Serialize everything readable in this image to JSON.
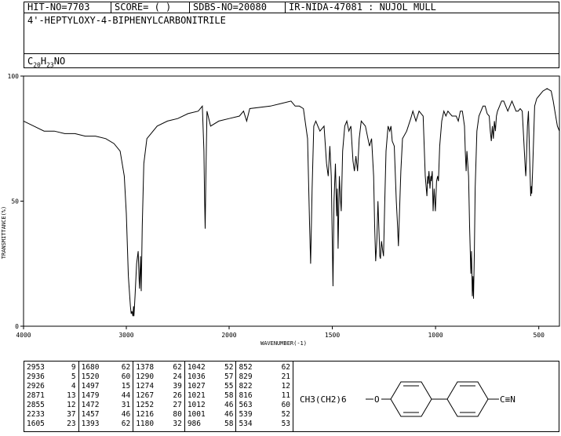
{
  "header": {
    "hit": "HIT-NO=7703",
    "score": "SCORE=  (   )",
    "sdbs": "SDBS-NO=20080",
    "ir": "IR-NIDA-47081 : NUJOL MULL"
  },
  "compound_name": "4'-HEPTYLOXY-4-BIPHENYLCARBONITRILE",
  "formula": {
    "c": "C",
    "c_n": "20",
    "h": "H",
    "h_n": "23",
    "rest": "NO"
  },
  "structure": {
    "left_group": "CH3(CH2)6",
    "o": "O",
    "cn": "C≡N"
  },
  "peaks": [
    [
      [
        2953,
        9
      ],
      [
        2936,
        5
      ],
      [
        2926,
        4
      ],
      [
        2871,
        13
      ],
      [
        2855,
        12
      ],
      [
        2233,
        37
      ],
      [
        1605,
        23
      ]
    ],
    [
      [
        1680,
        62
      ],
      [
        1520,
        60
      ],
      [
        1497,
        15
      ],
      [
        1479,
        44
      ],
      [
        1472,
        31
      ],
      [
        1457,
        46
      ],
      [
        1393,
        62
      ]
    ],
    [
      [
        1378,
        62
      ],
      [
        1290,
        24
      ],
      [
        1274,
        39
      ],
      [
        1267,
        26
      ],
      [
        1252,
        27
      ],
      [
        1216,
        80
      ],
      [
        1180,
        32
      ]
    ],
    [
      [
        1042,
        52
      ],
      [
        1036,
        57
      ],
      [
        1027,
        55
      ],
      [
        1021,
        58
      ],
      [
        1012,
        46
      ],
      [
        1001,
        46
      ],
      [
        986,
        58
      ]
    ],
    [
      [
        852,
        62
      ],
      [
        829,
        21
      ],
      [
        822,
        12
      ],
      [
        816,
        11
      ],
      [
        563,
        60
      ],
      [
        539,
        52
      ],
      [
        534,
        53
      ]
    ]
  ],
  "chart_data": {
    "type": "line",
    "xlabel": "WAVENUMBER(-1)",
    "ylabel": "TRANSMITTANCE(%)",
    "xlim": [
      4000,
      400
    ],
    "ylim": [
      0,
      100
    ],
    "x_ticks": [
      "4000",
      "3000",
      "2000",
      "1500",
      "1000",
      "500"
    ],
    "y_ticks": [
      "100",
      "50",
      "0"
    ],
    "points": [
      [
        4000,
        82
      ],
      [
        3900,
        80
      ],
      [
        3800,
        78
      ],
      [
        3700,
        78
      ],
      [
        3600,
        77
      ],
      [
        3500,
        77
      ],
      [
        3400,
        76
      ],
      [
        3300,
        76
      ],
      [
        3200,
        75
      ],
      [
        3120,
        73
      ],
      [
        3060,
        70
      ],
      [
        3020,
        60
      ],
      [
        3000,
        45
      ],
      [
        2980,
        20
      ],
      [
        2960,
        8
      ],
      [
        2953,
        5
      ],
      [
        2945,
        6
      ],
      [
        2936,
        4
      ],
      [
        2930,
        8
      ],
      [
        2926,
        4
      ],
      [
        2915,
        12
      ],
      [
        2900,
        25
      ],
      [
        2885,
        30
      ],
      [
        2875,
        18
      ],
      [
        2871,
        15
      ],
      [
        2862,
        28
      ],
      [
        2855,
        14
      ],
      [
        2845,
        40
      ],
      [
        2830,
        65
      ],
      [
        2800,
        75
      ],
      [
        2700,
        80
      ],
      [
        2600,
        82
      ],
      [
        2500,
        83
      ],
      [
        2400,
        85
      ],
      [
        2300,
        86
      ],
      [
        2260,
        88
      ],
      [
        2245,
        70
      ],
      [
        2238,
        50
      ],
      [
        2233,
        39
      ],
      [
        2226,
        60
      ],
      [
        2215,
        86
      ],
      [
        2180,
        80
      ],
      [
        2100,
        82
      ],
      [
        2000,
        83
      ],
      [
        1950,
        84
      ],
      [
        1930,
        86
      ],
      [
        1915,
        82
      ],
      [
        1900,
        87
      ],
      [
        1800,
        88
      ],
      [
        1750,
        89
      ],
      [
        1700,
        90
      ],
      [
        1680,
        88
      ],
      [
        1660,
        88
      ],
      [
        1640,
        87
      ],
      [
        1620,
        75
      ],
      [
        1610,
        40
      ],
      [
        1605,
        25
      ],
      [
        1598,
        55
      ],
      [
        1590,
        80
      ],
      [
        1580,
        82
      ],
      [
        1570,
        80
      ],
      [
        1560,
        78
      ],
      [
        1540,
        80
      ],
      [
        1528,
        65
      ],
      [
        1520,
        60
      ],
      [
        1512,
        72
      ],
      [
        1505,
        60
      ],
      [
        1497,
        16
      ],
      [
        1492,
        50
      ],
      [
        1485,
        65
      ],
      [
        1479,
        44
      ],
      [
        1476,
        55
      ],
      [
        1472,
        31
      ],
      [
        1466,
        60
      ],
      [
        1460,
        50
      ],
      [
        1457,
        46
      ],
      [
        1450,
        70
      ],
      [
        1440,
        80
      ],
      [
        1430,
        82
      ],
      [
        1420,
        78
      ],
      [
        1410,
        80
      ],
      [
        1400,
        66
      ],
      [
        1393,
        62
      ],
      [
        1386,
        68
      ],
      [
        1378,
        62
      ],
      [
        1370,
        75
      ],
      [
        1360,
        82
      ],
      [
        1340,
        80
      ],
      [
        1320,
        72
      ],
      [
        1310,
        75
      ],
      [
        1300,
        60
      ],
      [
        1295,
        40
      ],
      [
        1290,
        26
      ],
      [
        1284,
        35
      ],
      [
        1279,
        50
      ],
      [
        1274,
        38
      ],
      [
        1270,
        28
      ],
      [
        1267,
        27
      ],
      [
        1262,
        34
      ],
      [
        1256,
        30
      ],
      [
        1252,
        28
      ],
      [
        1246,
        50
      ],
      [
        1240,
        70
      ],
      [
        1230,
        80
      ],
      [
        1222,
        78
      ],
      [
        1216,
        80
      ],
      [
        1210,
        74
      ],
      [
        1200,
        72
      ],
      [
        1190,
        50
      ],
      [
        1185,
        42
      ],
      [
        1180,
        32
      ],
      [
        1175,
        45
      ],
      [
        1168,
        62
      ],
      [
        1160,
        75
      ],
      [
        1140,
        78
      ],
      [
        1120,
        83
      ],
      [
        1110,
        86
      ],
      [
        1095,
        82
      ],
      [
        1080,
        86
      ],
      [
        1060,
        84
      ],
      [
        1050,
        60
      ],
      [
        1045,
        55
      ],
      [
        1042,
        52
      ],
      [
        1038,
        60
      ],
      [
        1036,
        57
      ],
      [
        1032,
        62
      ],
      [
        1027,
        55
      ],
      [
        1023,
        60
      ],
      [
        1021,
        58
      ],
      [
        1016,
        62
      ],
      [
        1012,
        46
      ],
      [
        1007,
        55
      ],
      [
        1001,
        46
      ],
      [
        995,
        58
      ],
      [
        990,
        60
      ],
      [
        986,
        58
      ],
      [
        980,
        72
      ],
      [
        970,
        82
      ],
      [
        960,
        86
      ],
      [
        950,
        84
      ],
      [
        940,
        86
      ],
      [
        930,
        85
      ],
      [
        920,
        84
      ],
      [
        900,
        84
      ],
      [
        890,
        82
      ],
      [
        880,
        86
      ],
      [
        870,
        86
      ],
      [
        860,
        80
      ],
      [
        856,
        70
      ],
      [
        852,
        62
      ],
      [
        848,
        70
      ],
      [
        840,
        60
      ],
      [
        835,
        40
      ],
      [
        829,
        21
      ],
      [
        826,
        30
      ],
      [
        822,
        12
      ],
      [
        819,
        20
      ],
      [
        816,
        11
      ],
      [
        812,
        30
      ],
      [
        808,
        55
      ],
      [
        800,
        78
      ],
      [
        790,
        84
      ],
      [
        780,
        86
      ],
      [
        770,
        88
      ],
      [
        760,
        88
      ],
      [
        750,
        85
      ],
      [
        740,
        84
      ],
      [
        735,
        78
      ],
      [
        730,
        74
      ],
      [
        725,
        80
      ],
      [
        720,
        75
      ],
      [
        715,
        82
      ],
      [
        710,
        78
      ],
      [
        705,
        84
      ],
      [
        700,
        86
      ],
      [
        690,
        88
      ],
      [
        680,
        90
      ],
      [
        670,
        90
      ],
      [
        660,
        88
      ],
      [
        650,
        86
      ],
      [
        640,
        88
      ],
      [
        630,
        90
      ],
      [
        620,
        88
      ],
      [
        610,
        86
      ],
      [
        600,
        86
      ],
      [
        590,
        87
      ],
      [
        580,
        86
      ],
      [
        570,
        70
      ],
      [
        566,
        64
      ],
      [
        563,
        60
      ],
      [
        560,
        66
      ],
      [
        555,
        80
      ],
      [
        550,
        86
      ],
      [
        545,
        70
      ],
      [
        539,
        52
      ],
      [
        536,
        56
      ],
      [
        534,
        53
      ],
      [
        530,
        62
      ],
      [
        525,
        75
      ],
      [
        520,
        88
      ],
      [
        510,
        91
      ],
      [
        500,
        92
      ],
      [
        480,
        94
      ],
      [
        460,
        95
      ],
      [
        440,
        94
      ],
      [
        430,
        90
      ],
      [
        420,
        85
      ],
      [
        410,
        80
      ],
      [
        400,
        78
      ]
    ]
  }
}
